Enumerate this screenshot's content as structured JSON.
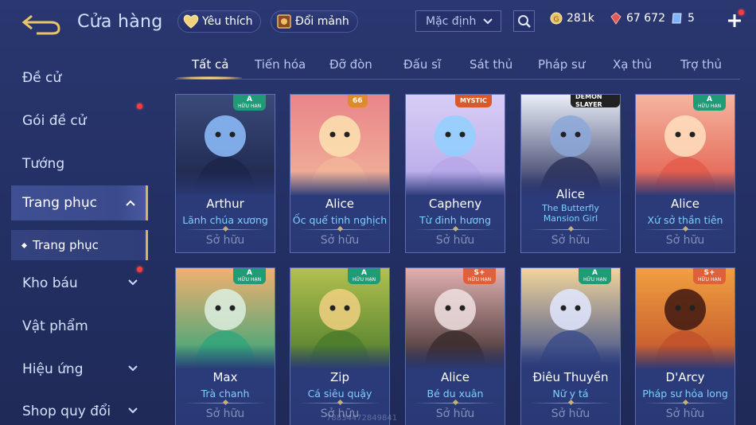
{
  "header": {
    "title": "Cửa hàng",
    "favorites_label": "Yêu thích",
    "exchange_label": "Đổi mảnh",
    "sort": {
      "selected": "Mặc định"
    },
    "currencies": [
      {
        "name": "gold",
        "value": "281k",
        "color": "#e9c46a"
      },
      {
        "name": "coupon",
        "value": "67 672",
        "color": "#e05a5a"
      },
      {
        "name": "voucher",
        "value": "5",
        "color": "#7fb2ff"
      }
    ]
  },
  "sidebar": {
    "items": [
      {
        "label": "Đề cử"
      },
      {
        "label": "Gói đề cử"
      },
      {
        "label": "Tướng"
      },
      {
        "label": "Trang phục"
      },
      {
        "label": "Kho báu"
      },
      {
        "label": "Vật phẩm"
      },
      {
        "label": "Hiệu ứng"
      },
      {
        "label": "Shop quy đổi"
      }
    ],
    "sub_item": "Trang phục"
  },
  "tabs": [
    "Tất cả",
    "Tiến hóa",
    "Đỡ đòn",
    "Đấu sĩ",
    "Sát thủ",
    "Pháp sư",
    "Xạ thủ",
    "Trợ thủ"
  ],
  "active_tab": "Tất cả",
  "cards": [
    {
      "hero": "Arthur",
      "skin": "Lãnh chúa xương",
      "status": "Sở hữu",
      "badge": "A",
      "badge_sub": "HỮU HẠN"
    },
    {
      "hero": "Alice",
      "skin": "Ốc quế tinh nghịch",
      "status": "Sở hữu",
      "badge": "66",
      "badge_sub": ""
    },
    {
      "hero": "Capheny",
      "skin": "Từ đinh hương",
      "status": "Sở hữu",
      "badge": "MYSTIC",
      "badge_sub": ""
    },
    {
      "hero": "Alice",
      "skin": "The Butterfly Mansion Girl",
      "status": "Sở hữu",
      "badge": "DEMON SLAYER",
      "badge_sub": ""
    },
    {
      "hero": "Alice",
      "skin": "Xứ sở thần tiên",
      "status": "Sở hữu",
      "badge": "A",
      "badge_sub": "HỮU HẠN"
    },
    {
      "hero": "Max",
      "skin": "Trà chanh",
      "status": "Sở hữu",
      "badge": "A",
      "badge_sub": "HỮU HẠN"
    },
    {
      "hero": "Zip",
      "skin": "Cá siêu quậy",
      "status": "Sở hữu",
      "badge": "A",
      "badge_sub": "HỮU HẠN"
    },
    {
      "hero": "Alice",
      "skin": "Bé du xuân",
      "status": "Sở hữu",
      "badge": "S+",
      "badge_sub": "HỮU HẠN"
    },
    {
      "hero": "Điêu Thuyền",
      "skin": "Nữ y tá",
      "status": "Sở hữu",
      "badge": "A",
      "badge_sub": "HỮU HẠN"
    },
    {
      "hero": "D'Arcy",
      "skin": "Pháp sư hỏa long",
      "status": "Sở hữu",
      "badge": "S+",
      "badge_sub": "HỮU HẠN"
    }
  ],
  "watermark": "7883447284​9841"
}
